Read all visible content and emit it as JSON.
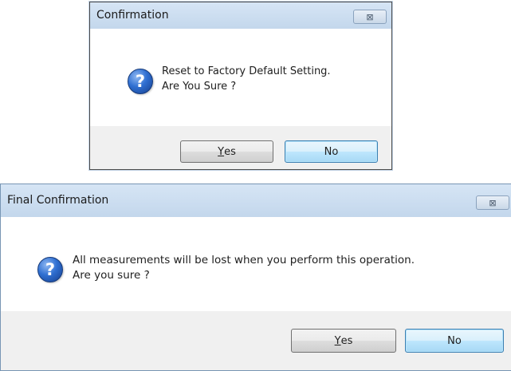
{
  "dialog1": {
    "title": "Confirmation",
    "close_glyph": "⊠",
    "icon": "question-icon",
    "icon_glyph": "?",
    "message_line1": "Reset to Factory Default Setting.",
    "message_line2": "Are You Sure ?",
    "yes_mnemonic": "Y",
    "yes_rest": "es",
    "no_label": "No"
  },
  "dialog2": {
    "title": "Final Confirmation",
    "close_glyph": "⊠",
    "icon": "question-icon",
    "icon_glyph": "?",
    "message_line1": "All measurements will be lost when you perform this operation.",
    "message_line2": "Are you sure ?",
    "yes_mnemonic": "Y",
    "yes_rest": "es",
    "no_label": "No"
  },
  "colors": {
    "titlebar": "#c8dbef",
    "default_button": "#bee6fd",
    "icon_blue": "#2f6fd1"
  }
}
